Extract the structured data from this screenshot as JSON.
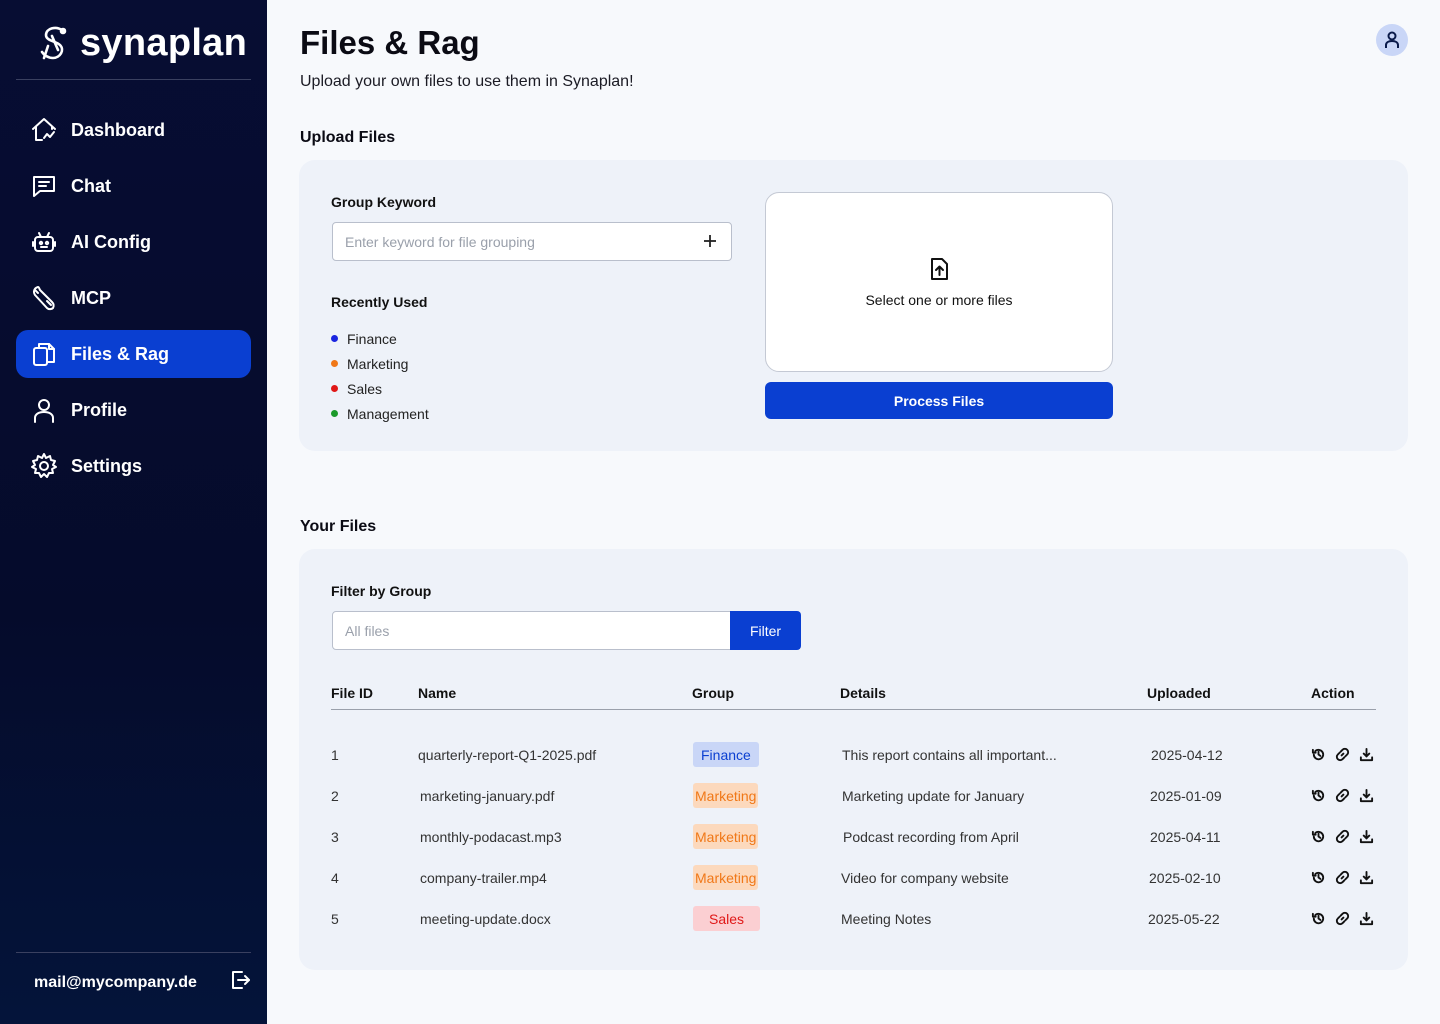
{
  "brand": {
    "name": "synaplan"
  },
  "sidebar": {
    "items": [
      {
        "label": "Dashboard",
        "icon": "house-icon",
        "active": false
      },
      {
        "label": "Chat",
        "icon": "chat-icon",
        "active": false
      },
      {
        "label": "AI Config",
        "icon": "robot-icon",
        "active": false
      },
      {
        "label": "MCP",
        "icon": "wrench-icon",
        "active": false
      },
      {
        "label": "Files & Rag",
        "icon": "files-icon",
        "active": true
      },
      {
        "label": "Profile",
        "icon": "user-icon",
        "active": false
      },
      {
        "label": "Settings",
        "icon": "gear-icon",
        "active": false
      }
    ],
    "email": "mail@mycompany.de",
    "logout_icon": "logout-icon"
  },
  "header": {
    "title": "Files & Rag",
    "subtitle": "Upload your own files to use them in Synaplan!"
  },
  "upload": {
    "section_title": "Upload Files",
    "keyword_label": "Group Keyword",
    "keyword_placeholder": "Enter keyword for file grouping",
    "recent_label": "Recently Used",
    "recent": [
      {
        "label": "Finance",
        "color": "#1a25e0"
      },
      {
        "label": "Marketing",
        "color": "#f07818"
      },
      {
        "label": "Sales",
        "color": "#e01818"
      },
      {
        "label": "Management",
        "color": "#1a9a2a"
      }
    ],
    "dropzone_text": "Select one or more files",
    "process_label": "Process Files"
  },
  "files": {
    "section_title": "Your Files",
    "filter_label": "Filter by Group",
    "filter_placeholder": "All files",
    "filter_button": "Filter",
    "columns": [
      "File ID",
      "Name",
      "Group",
      "Details",
      "Uploaded",
      "Action"
    ],
    "rows": [
      {
        "id": "1",
        "name": "quarterly-report-Q1-2025.pdf",
        "group": "Finance",
        "details": "This report contains all important...",
        "uploaded": "2025-04-12"
      },
      {
        "id": "2",
        "name": "marketing-january.pdf",
        "group": "Marketing",
        "details": "Marketing update for January",
        "uploaded": "2025-01-09"
      },
      {
        "id": "3",
        "name": "monthly-podacast.mp3",
        "group": "Marketing",
        "details": "Podcast recording from April",
        "uploaded": "2025-04-11"
      },
      {
        "id": "4",
        "name": "company-trailer.mp4",
        "group": "Marketing",
        "details": "Video for company website",
        "uploaded": "2025-02-10"
      },
      {
        "id": "5",
        "name": "meeting-update.docx",
        "group": "Sales",
        "details": "Meeting Notes",
        "uploaded": "2025-05-22"
      }
    ],
    "group_colors": {
      "Finance": {
        "bg": "#c9d6f7",
        "fg": "#0a3fd1"
      },
      "Marketing": {
        "bg": "#fcd9bd",
        "fg": "#f07818"
      },
      "Sales": {
        "bg": "#fbcfd2",
        "fg": "#e01818"
      }
    }
  }
}
